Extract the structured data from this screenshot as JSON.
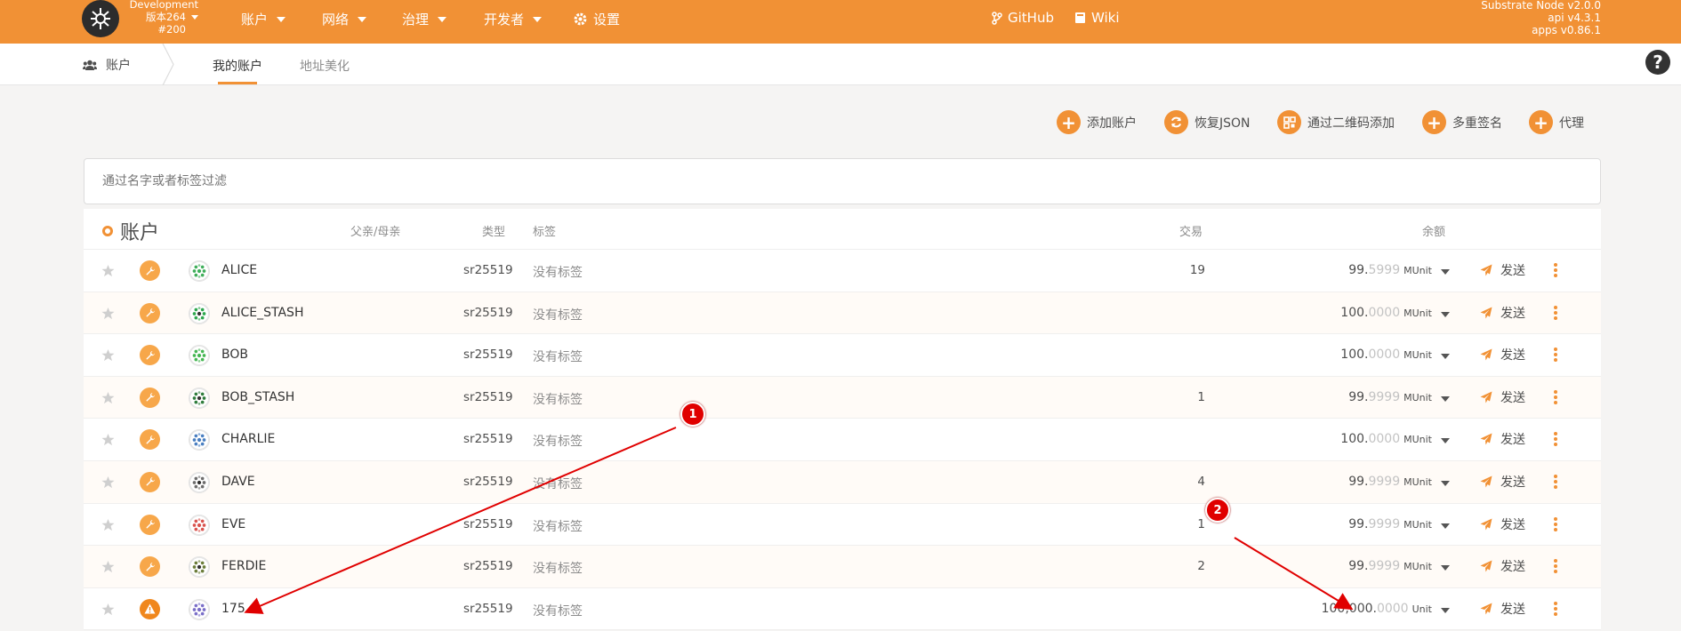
{
  "topbar": {
    "chain_name": "Development",
    "version": "版本264",
    "block": "#200",
    "nav": {
      "accounts": "账户",
      "network": "网络",
      "governance": "治理",
      "developer": "开发者",
      "settings": "设置",
      "github": "GitHub",
      "wiki": "Wiki"
    },
    "node": {
      "line1": "Substrate Node v2.0.0",
      "line2": "api v4.3.1",
      "line3": "apps v0.86.1"
    },
    "color": "#f19135"
  },
  "tabs": {
    "section": "账户",
    "my_accounts": "我的账户",
    "vanity": "地址美化"
  },
  "actions": {
    "add": "添加账户",
    "restore": "恢复JSON",
    "qr": "通过二维码添加",
    "multisig": "多重签名",
    "proxy": "代理"
  },
  "filter": {
    "placeholder": "通过名字或者标签过滤"
  },
  "table": {
    "title": "账户",
    "headers": {
      "parent": "父亲/母亲",
      "type": "类型",
      "tags": "标签",
      "tx": "交易",
      "balance": "余额"
    },
    "rows": [
      {
        "name": "ALICE",
        "type": "sr25519",
        "tags": "没有标签",
        "tx": "19",
        "bal_int": "99.",
        "bal_dec": "5999",
        "unit": "MUnit",
        "send": "发送",
        "badge": "wrench-icon"
      },
      {
        "name": "ALICE_STASH",
        "type": "sr25519",
        "tags": "没有标签",
        "tx": "",
        "bal_int": "100.",
        "bal_dec": "0000",
        "unit": "MUnit",
        "send": "发送",
        "badge": "wrench-icon"
      },
      {
        "name": "BOB",
        "type": "sr25519",
        "tags": "没有标签",
        "tx": "",
        "bal_int": "100.",
        "bal_dec": "0000",
        "unit": "MUnit",
        "send": "发送",
        "badge": "wrench-icon"
      },
      {
        "name": "BOB_STASH",
        "type": "sr25519",
        "tags": "没有标签",
        "tx": "1",
        "bal_int": "99.",
        "bal_dec": "9999",
        "unit": "MUnit",
        "send": "发送",
        "badge": "wrench-icon"
      },
      {
        "name": "CHARLIE",
        "type": "sr25519",
        "tags": "没有标签",
        "tx": "",
        "bal_int": "100.",
        "bal_dec": "0000",
        "unit": "MUnit",
        "send": "发送",
        "badge": "wrench-icon"
      },
      {
        "name": "DAVE",
        "type": "sr25519",
        "tags": "没有标签",
        "tx": "4",
        "bal_int": "99.",
        "bal_dec": "9999",
        "unit": "MUnit",
        "send": "发送",
        "badge": "wrench-icon"
      },
      {
        "name": "EVE",
        "type": "sr25519",
        "tags": "没有标签",
        "tx": "1",
        "bal_int": "99.",
        "bal_dec": "9999",
        "unit": "MUnit",
        "send": "发送",
        "badge": "wrench-icon"
      },
      {
        "name": "FERDIE",
        "type": "sr25519",
        "tags": "没有标签",
        "tx": "2",
        "bal_int": "99.",
        "bal_dec": "9999",
        "unit": "MUnit",
        "send": "发送",
        "badge": "wrench-icon"
      },
      {
        "name": "175",
        "type": "sr25519",
        "tags": "没有标签",
        "tx": "",
        "bal_int": "100,000.",
        "bal_dec": "0000",
        "unit": "Unit",
        "send": "发送",
        "badge": "warning-icon"
      }
    ]
  },
  "annotations": [
    "1",
    "2"
  ]
}
